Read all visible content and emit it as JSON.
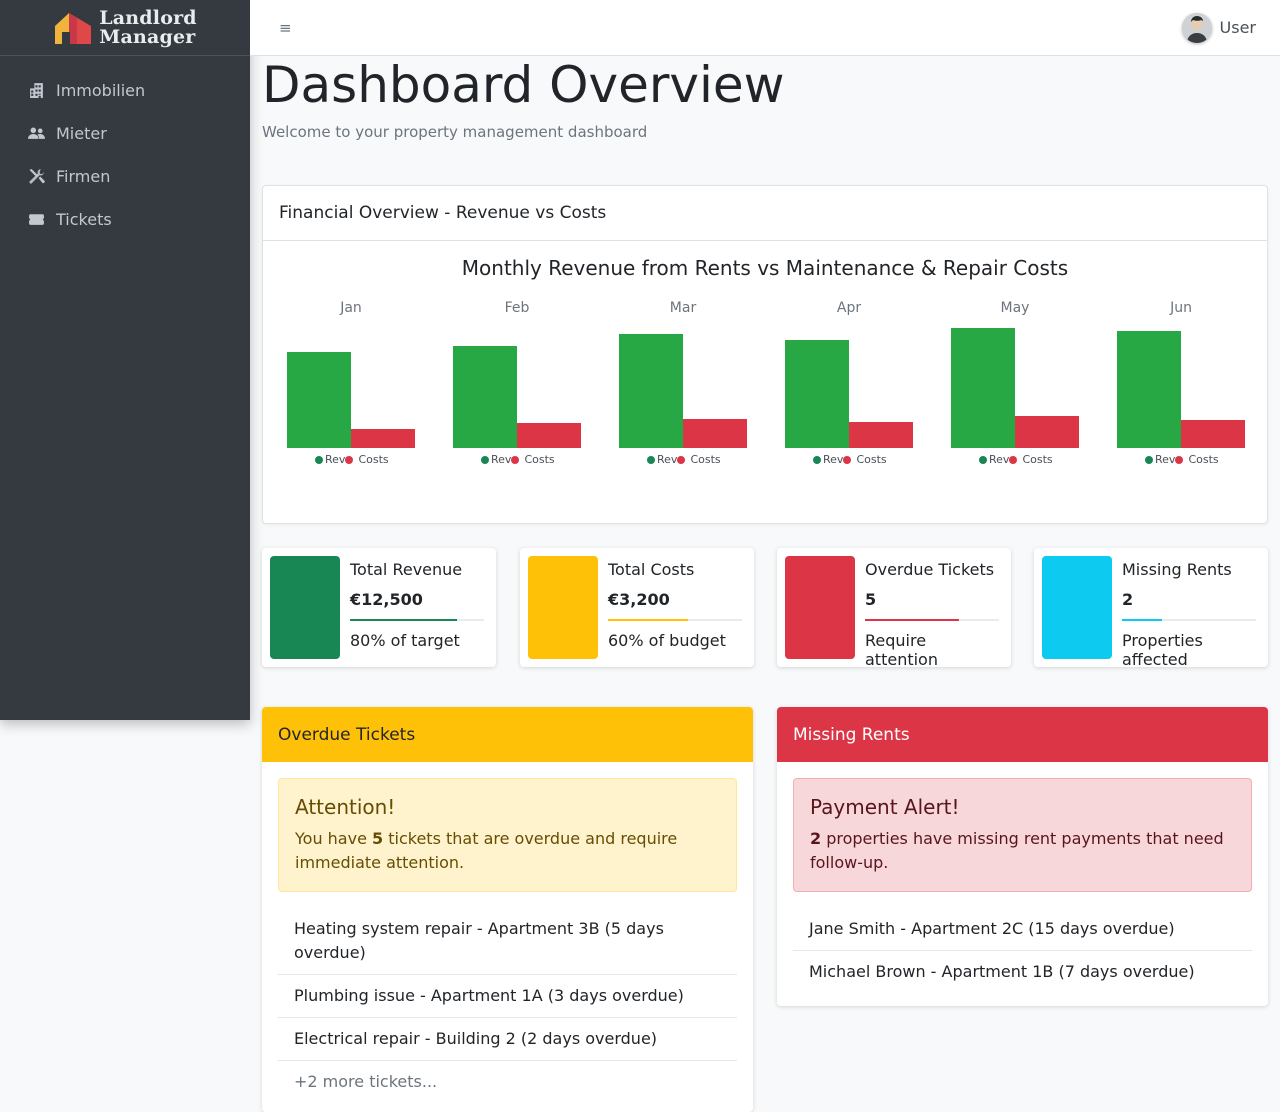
{
  "brand": {
    "line1": "Landlord",
    "line2": "Manager"
  },
  "sidebar": {
    "items": [
      {
        "label": "Immobilien",
        "icon": "building-icon"
      },
      {
        "label": "Mieter",
        "icon": "users-icon"
      },
      {
        "label": "Firmen",
        "icon": "tools-icon"
      },
      {
        "label": "Tickets",
        "icon": "ticket-icon"
      }
    ]
  },
  "topbar": {
    "menu_icon": "≡",
    "user_label": "User"
  },
  "header": {
    "title": "Dashboard Overview",
    "subtitle": "Welcome to your property management dashboard"
  },
  "financial": {
    "card_title": "Financial Overview - Revenue vs Costs"
  },
  "chart_data": {
    "type": "bar",
    "title": "Monthly Revenue from Rents vs Maintenance & Repair Costs",
    "categories": [
      "Jan",
      "Feb",
      "Mar",
      "Apr",
      "May",
      "Jun"
    ],
    "series": [
      {
        "name": "Rev",
        "color": "#28a745",
        "values": [
          96,
          102,
          114,
          108,
          120,
          117
        ]
      },
      {
        "name": "Costs",
        "color": "#dc3545",
        "values": [
          19,
          25,
          29,
          26,
          32,
          28
        ]
      }
    ],
    "legend": {
      "rev_label": "Rev",
      "costs_label": "Costs"
    },
    "xlabel": "",
    "ylabel": ""
  },
  "stats": [
    {
      "label": "Total Revenue",
      "value": "€12,500",
      "desc": "80% of target",
      "color": "#198754",
      "progress": 0.8
    },
    {
      "label": "Total Costs",
      "value": "€3,200",
      "desc": "60% of budget",
      "color": "#ffc107",
      "progress": 0.6
    },
    {
      "label": "Overdue Tickets",
      "value": "5",
      "desc": "Require attention",
      "color": "#dc3545",
      "progress": 0.7
    },
    {
      "label": "Missing Rents",
      "value": "2",
      "desc": "Properties affected",
      "color": "#0dcaf0",
      "progress": 0.3
    }
  ],
  "overdue": {
    "title": "Overdue Tickets",
    "header_color": "#ffc107",
    "alert_title": "Attention!",
    "alert_pre": "You have ",
    "alert_count": "5",
    "alert_post": " tickets that are overdue and require immediate attention.",
    "items": [
      "Heating system repair - Apartment 3B (5 days overdue)",
      "Plumbing issue - Apartment 1A (3 days overdue)",
      "Electrical repair - Building 2 (2 days overdue)",
      "+2 more tickets..."
    ]
  },
  "missing": {
    "title": "Missing Rents",
    "header_color": "#dc3545",
    "alert_title": "Payment Alert!",
    "alert_count": "2",
    "alert_post": " properties have missing rent payments that need follow-up.",
    "items": [
      "Jane Smith - Apartment 2C (15 days overdue)",
      "Michael Brown - Apartment 1B (7 days overdue)"
    ]
  }
}
